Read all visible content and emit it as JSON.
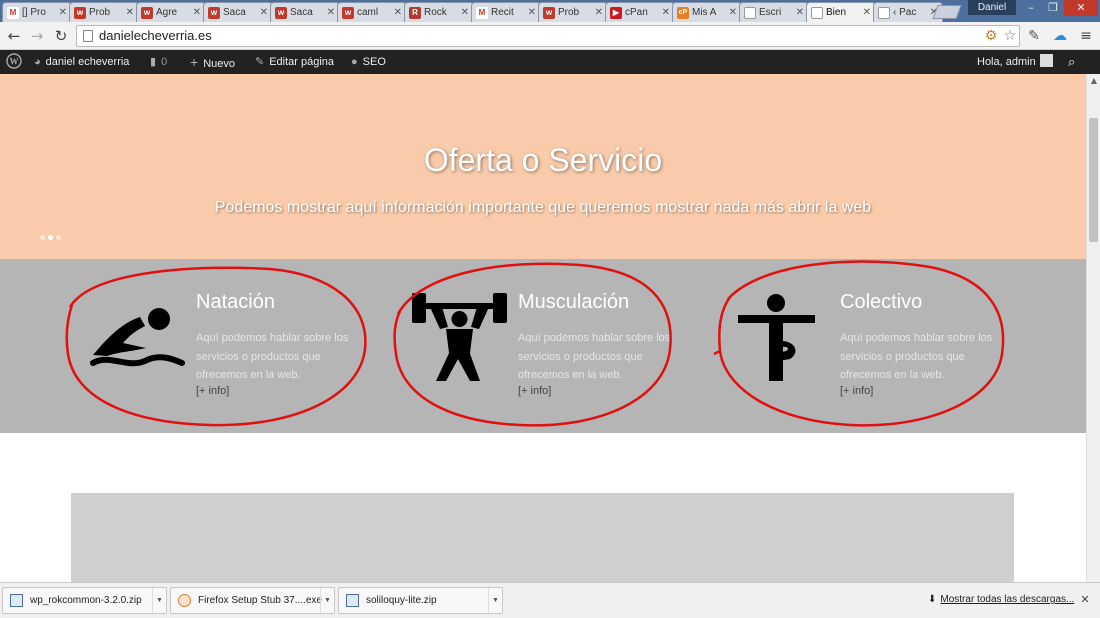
{
  "browser": {
    "tabs": [
      {
        "icon": "gmail-icon",
        "label": "[] Pro",
        "color": "#c0392b",
        "glyph": "M"
      },
      {
        "icon": "wix-icon",
        "label": "Prob",
        "color": "#c0392b",
        "glyph": "w"
      },
      {
        "icon": "wix-icon",
        "label": "Agre",
        "color": "#c0392b",
        "glyph": "w"
      },
      {
        "icon": "wix-icon",
        "label": "Saca",
        "color": "#c0392b",
        "glyph": "w"
      },
      {
        "icon": "wix-icon",
        "label": "Saca",
        "color": "#c0392b",
        "glyph": "w"
      },
      {
        "icon": "wix-icon",
        "label": "caml",
        "color": "#c0392b",
        "glyph": "w"
      },
      {
        "icon": "rocket-icon",
        "label": "Rock",
        "color": "#b03a2e",
        "glyph": "R"
      },
      {
        "icon": "gmail-icon",
        "label": "Recit",
        "color": "#c0392b",
        "glyph": "M"
      },
      {
        "icon": "wix-icon",
        "label": "Prob",
        "color": "#c0392b",
        "glyph": "w"
      },
      {
        "icon": "youtube-icon",
        "label": "cPan",
        "color": "#cc181e",
        "glyph": "▶"
      },
      {
        "icon": "cpanel-icon",
        "label": "Mis A",
        "color": "#e67e22",
        "glyph": "cP"
      },
      {
        "icon": "page-icon",
        "label": "Escri",
        "color": "#ffffff",
        "glyph": ""
      },
      {
        "icon": "page-icon",
        "label": "Bien",
        "color": "#ffffff",
        "glyph": "",
        "active": true
      },
      {
        "icon": "page-icon",
        "label": "‹ Pac",
        "color": "#ffffff",
        "glyph": ""
      }
    ],
    "user": "Daniel",
    "url": "danielecheverria.es"
  },
  "adminbar": {
    "site_name": "daniel echeverria",
    "comments_count": "0",
    "new_label": "Nuevo",
    "edit_label": "Editar página",
    "seo_label": "SEO",
    "greeting": "Hola, admin"
  },
  "hero": {
    "title": "Oferta o Servicio",
    "subtitle": "Podemos mostrar aquí información importante que queremos mostrar nada más abrir la web",
    "slide_count": 3,
    "active_slide": 1
  },
  "services": [
    {
      "title": "Natación",
      "text": "Aquí podemos hablar sobre los servicios o productos que ofrecemos en la web.",
      "link": "[+ info]",
      "icon": "swimmer-icon"
    },
    {
      "title": "Musculación",
      "text": "Aquí podemos hablar sobre los servicios o productos que ofrecemos en la web.",
      "link": "[+ info]",
      "icon": "weightlifter-icon"
    },
    {
      "title": "Colectivo",
      "text": "Aquí podemos hablar sobre los servicios o productos que ofrecemos en la web.",
      "link": "[+ info]",
      "icon": "yoga-icon"
    }
  ],
  "downloads": [
    {
      "name": "wp_rokcommon-3.2.0.zip"
    },
    {
      "name": "Firefox Setup Stub 37....exe"
    },
    {
      "name": "soliloquy-lite.zip"
    }
  ],
  "downloads_show_all": "Mostrar todas las descargas...",
  "colors": {
    "hero_bg": "#f9cbaa",
    "services_bg": "#b5b5b5",
    "annotation": "#e01010",
    "adminbar_bg": "#222222"
  }
}
